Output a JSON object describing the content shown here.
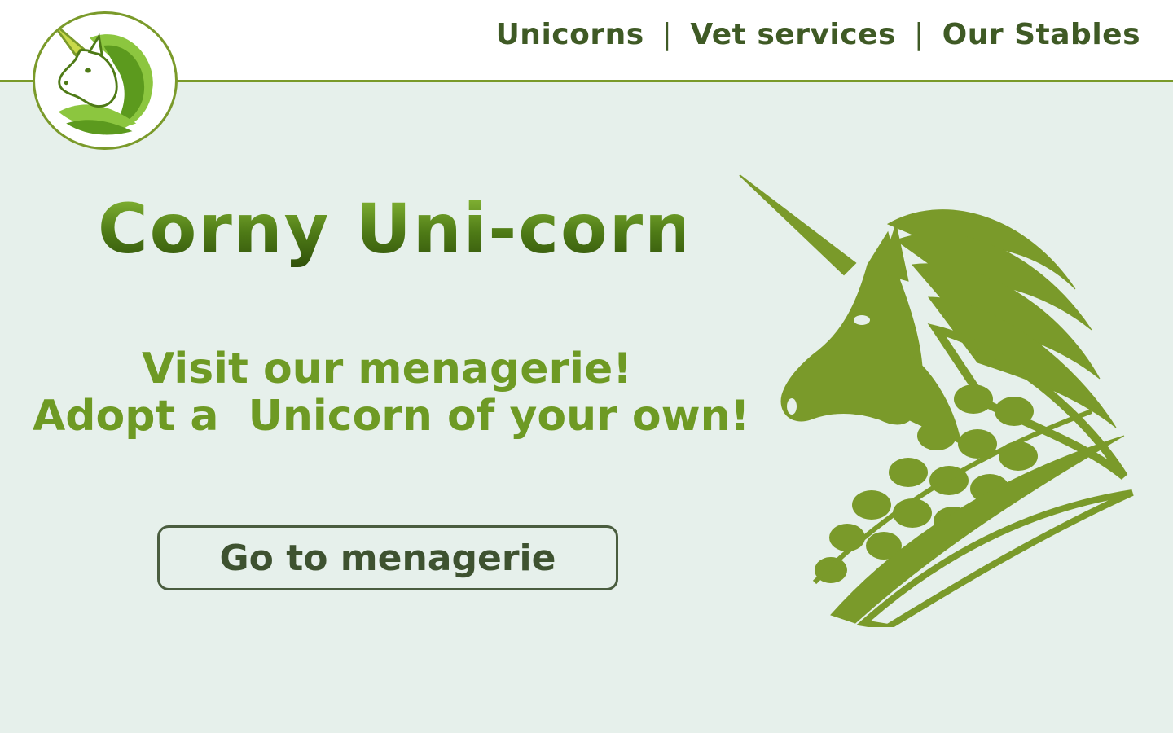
{
  "header": {
    "logo_icon": "unicorn-logo-icon",
    "nav": {
      "items": [
        {
          "label": "Unicorns"
        },
        {
          "label": "Vet services"
        },
        {
          "label": "Our Stables"
        }
      ],
      "separator": "|"
    }
  },
  "hero": {
    "title": "Corny Uni-corn",
    "tagline": "Visit our menagerie!\nAdopt a  Unicorn of your own!",
    "cta_label": "Go to menagerie",
    "illustration_icon": "corn-unicorn-illustration"
  },
  "colors": {
    "accent": "#7a9a2a",
    "nav_text": "#3f5a25",
    "tagline": "#6e9a24",
    "background": "#e6f0eb"
  }
}
